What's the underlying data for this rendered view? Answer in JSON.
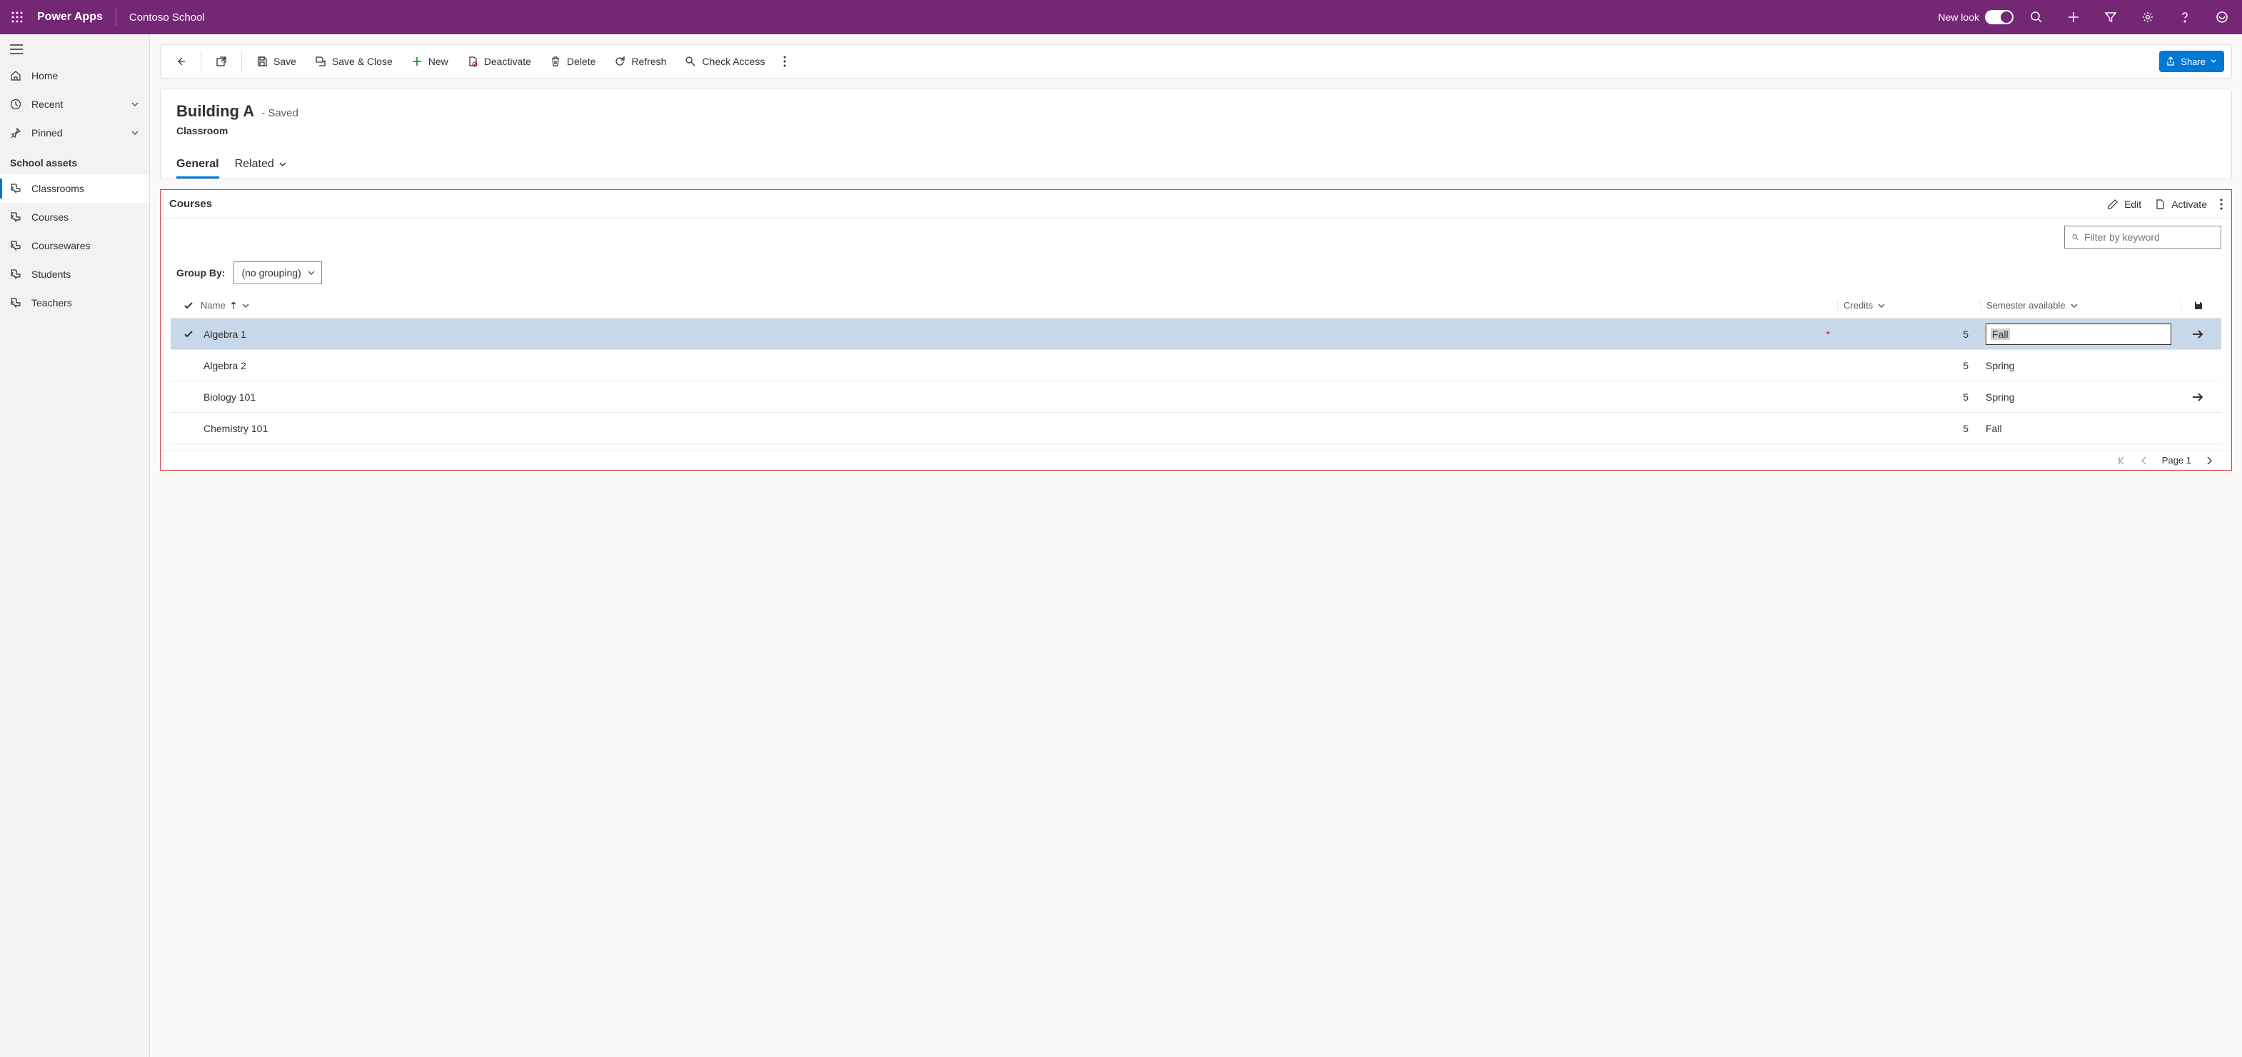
{
  "header": {
    "app_title": "Power Apps",
    "env_name": "Contoso School",
    "new_look_label": "New look"
  },
  "sidebar": {
    "home": "Home",
    "recent": "Recent",
    "pinned": "Pinned",
    "section_title": "School assets",
    "items": [
      {
        "label": "Classrooms",
        "active": true
      },
      {
        "label": "Courses"
      },
      {
        "label": "Coursewares"
      },
      {
        "label": "Students"
      },
      {
        "label": "Teachers"
      }
    ]
  },
  "commands": {
    "save": "Save",
    "save_close": "Save & Close",
    "new": "New",
    "deactivate": "Deactivate",
    "delete": "Delete",
    "refresh": "Refresh",
    "check_access": "Check Access",
    "share": "Share"
  },
  "record": {
    "title": "Building A",
    "status": "- Saved",
    "entity": "Classroom",
    "tab_general": "General",
    "tab_related": "Related"
  },
  "subgrid": {
    "title": "Courses",
    "edit": "Edit",
    "activate": "Activate",
    "filter_placeholder": "Filter by keyword",
    "groupby_label": "Group By:",
    "groupby_value": "(no grouping)",
    "columns": {
      "name": "Name",
      "credits": "Credits",
      "semester": "Semester available"
    },
    "rows": [
      {
        "name": "Algebra 1",
        "credits": "5",
        "semester": "Fall",
        "selected": true,
        "editing": true,
        "required": true,
        "arrow": true
      },
      {
        "name": "Algebra 2",
        "credits": "5",
        "semester": "Spring"
      },
      {
        "name": "Biology 101",
        "credits": "5",
        "semester": "Spring",
        "arrow": true
      },
      {
        "name": "Chemistry 101",
        "credits": "5",
        "semester": "Fall"
      }
    ],
    "page_label": "Page 1"
  }
}
